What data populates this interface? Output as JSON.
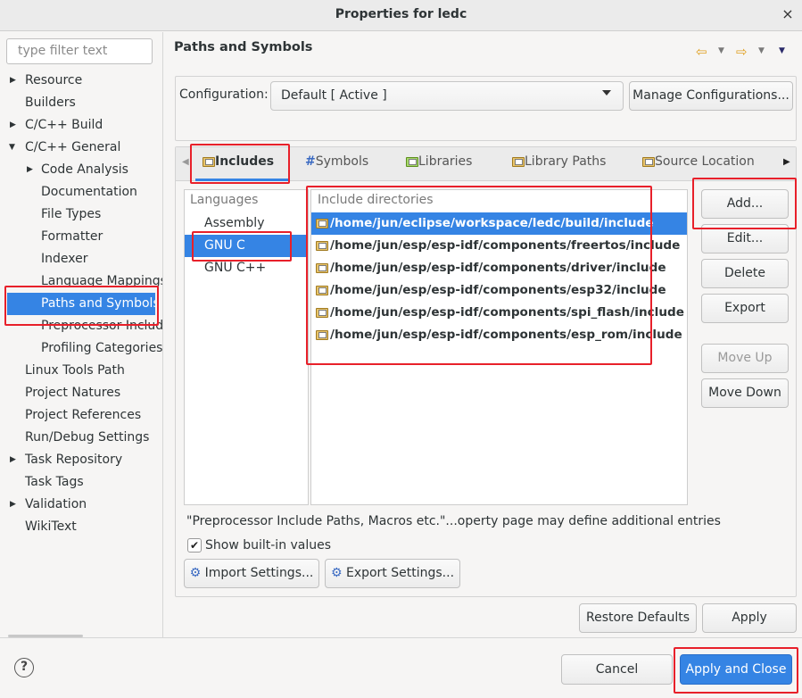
{
  "window": {
    "title": "Properties for ledc",
    "close_glyph": "×"
  },
  "filter": {
    "placeholder": "type filter text"
  },
  "tree": [
    {
      "label": "Resource",
      "arrow": "▶"
    },
    {
      "label": "Builders",
      "arrow": ""
    },
    {
      "label": "C/C++ Build",
      "arrow": "▶"
    },
    {
      "label": "C/C++ General",
      "arrow": "▼"
    },
    {
      "label": "Code Analysis",
      "arrow": "▶"
    },
    {
      "label": "Documentation",
      "arrow": ""
    },
    {
      "label": "File Types",
      "arrow": ""
    },
    {
      "label": "Formatter",
      "arrow": ""
    },
    {
      "label": "Indexer",
      "arrow": ""
    },
    {
      "label": "Language Mappings",
      "arrow": ""
    },
    {
      "label": "Paths and Symbols",
      "arrow": ""
    },
    {
      "label": "Preprocessor Include Paths, Macros etc.",
      "arrow": ""
    },
    {
      "label": "Profiling Categories",
      "arrow": ""
    },
    {
      "label": "Linux Tools Path",
      "arrow": ""
    },
    {
      "label": "Project Natures",
      "arrow": ""
    },
    {
      "label": "Project References",
      "arrow": ""
    },
    {
      "label": "Run/Debug Settings",
      "arrow": ""
    },
    {
      "label": "Task Repository",
      "arrow": "▶"
    },
    {
      "label": "Task Tags",
      "arrow": ""
    },
    {
      "label": "Validation",
      "arrow": "▶"
    },
    {
      "label": "WikiText",
      "arrow": ""
    }
  ],
  "page": {
    "title": "Paths and Symbols",
    "nav": {
      "back": "⇦",
      "forward": "⇨",
      "dropdown": "▼",
      "menu": "▼"
    }
  },
  "configuration": {
    "label": "Configuration:",
    "value": "Default  [ Active ]",
    "manage_button": "Manage Configurations..."
  },
  "tabs": [
    {
      "label": "Includes",
      "icon": "folder-include-icon",
      "prefix": ""
    },
    {
      "label": "Symbols",
      "icon": "hash-icon",
      "prefix": "#"
    },
    {
      "label": "Libraries",
      "icon": "library-icon",
      "prefix": ""
    },
    {
      "label": "Library Paths",
      "icon": "folder-library-icon",
      "prefix": ""
    },
    {
      "label": "Source Location",
      "icon": "folder-source-icon",
      "prefix": ""
    }
  ],
  "tab_scroll": {
    "left": "◀",
    "right": "▶"
  },
  "languages": {
    "header": "Languages",
    "items": [
      "Assembly",
      "GNU C",
      "GNU C++"
    ]
  },
  "includes": {
    "header": "Include directories",
    "items": [
      "/home/jun/eclipse/workspace/ledc/build/include",
      "/home/jun/esp/esp-idf/components/freertos/include",
      "/home/jun/esp/esp-idf/components/driver/include",
      "/home/jun/esp/esp-idf/components/esp32/include",
      "/home/jun/esp/esp-idf/components/spi_flash/include",
      "/home/jun/esp/esp-idf/components/esp_rom/include"
    ]
  },
  "side_buttons": {
    "add": "Add...",
    "edit": "Edit...",
    "delete": "Delete",
    "export": "Export",
    "move_up": "Move Up",
    "move_down": "Move Down"
  },
  "note": "\"Preprocessor Include Paths, Macros etc.\"...operty page may define additional entries",
  "show_builtin": {
    "label": "Show built-in values",
    "checked": "✔"
  },
  "settings_buttons": {
    "import": "Import Settings...",
    "export": "Export Settings..."
  },
  "page_buttons": {
    "restore": "Restore Defaults",
    "apply": "Apply"
  },
  "dialog_buttons": {
    "cancel": "Cancel",
    "apply_close": "Apply and Close"
  },
  "help": {
    "glyph": "?"
  },
  "colors": {
    "selection": "#3584e4",
    "highlight": "#e8202a",
    "folder": "#e8c46a"
  }
}
